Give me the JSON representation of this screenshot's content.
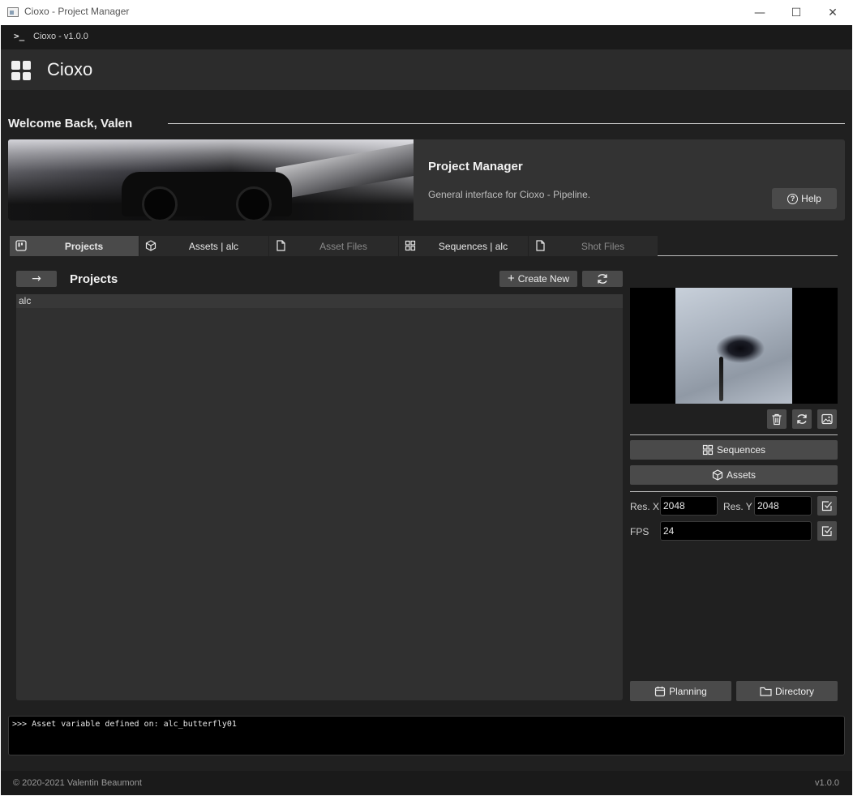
{
  "window": {
    "title": "Cioxo - Project Manager",
    "minimize_glyph": "—",
    "maximize_glyph": "☐",
    "close_glyph": "✕"
  },
  "version_bar": {
    "prompt_glyph": ">_",
    "text": "Cioxo  - v1.0.0"
  },
  "brand": {
    "name": "Cioxo",
    "icon": "grid-icon"
  },
  "welcome": "Welcome Back, Valen",
  "banner": {
    "title": "Project Manager",
    "description": "General interface for Cioxo - Pipeline.",
    "help_label": "Help",
    "help_glyph": "?"
  },
  "tabs": [
    {
      "label": "Projects",
      "icon": "board-icon",
      "active": true
    },
    {
      "label": "Assets | alc",
      "icon": "cube-icon",
      "active": false
    },
    {
      "label": "Asset Files",
      "icon": "file-icon",
      "active": false
    },
    {
      "label": "Sequences | alc",
      "icon": "grid-icon",
      "active": false
    },
    {
      "label": "Shot Files",
      "icon": "file-icon",
      "active": false
    }
  ],
  "projects": {
    "back_glyph": "→",
    "title": "Projects",
    "create_label": "Create New",
    "create_glyph": "+",
    "items": [
      "alc"
    ]
  },
  "side": {
    "sequences_label": "Sequences",
    "assets_label": "Assets",
    "res_x_label": "Res. X",
    "res_x_value": "2048",
    "res_y_label": "Res. Y",
    "res_y_value": "2048",
    "fps_label": "FPS",
    "fps_value": "24",
    "planning_label": "Planning",
    "directory_label": "Directory"
  },
  "console": {
    "text": ">>> Asset variable defined on: alc_butterfly01"
  },
  "footer": {
    "copyright": "© 2020-2021 Valentin Beaumont",
    "version": "v1.0.0"
  },
  "colors": {
    "background": "#202020",
    "panel": "#303030",
    "button": "#4a4a4a",
    "text": "#f2f2f2"
  }
}
